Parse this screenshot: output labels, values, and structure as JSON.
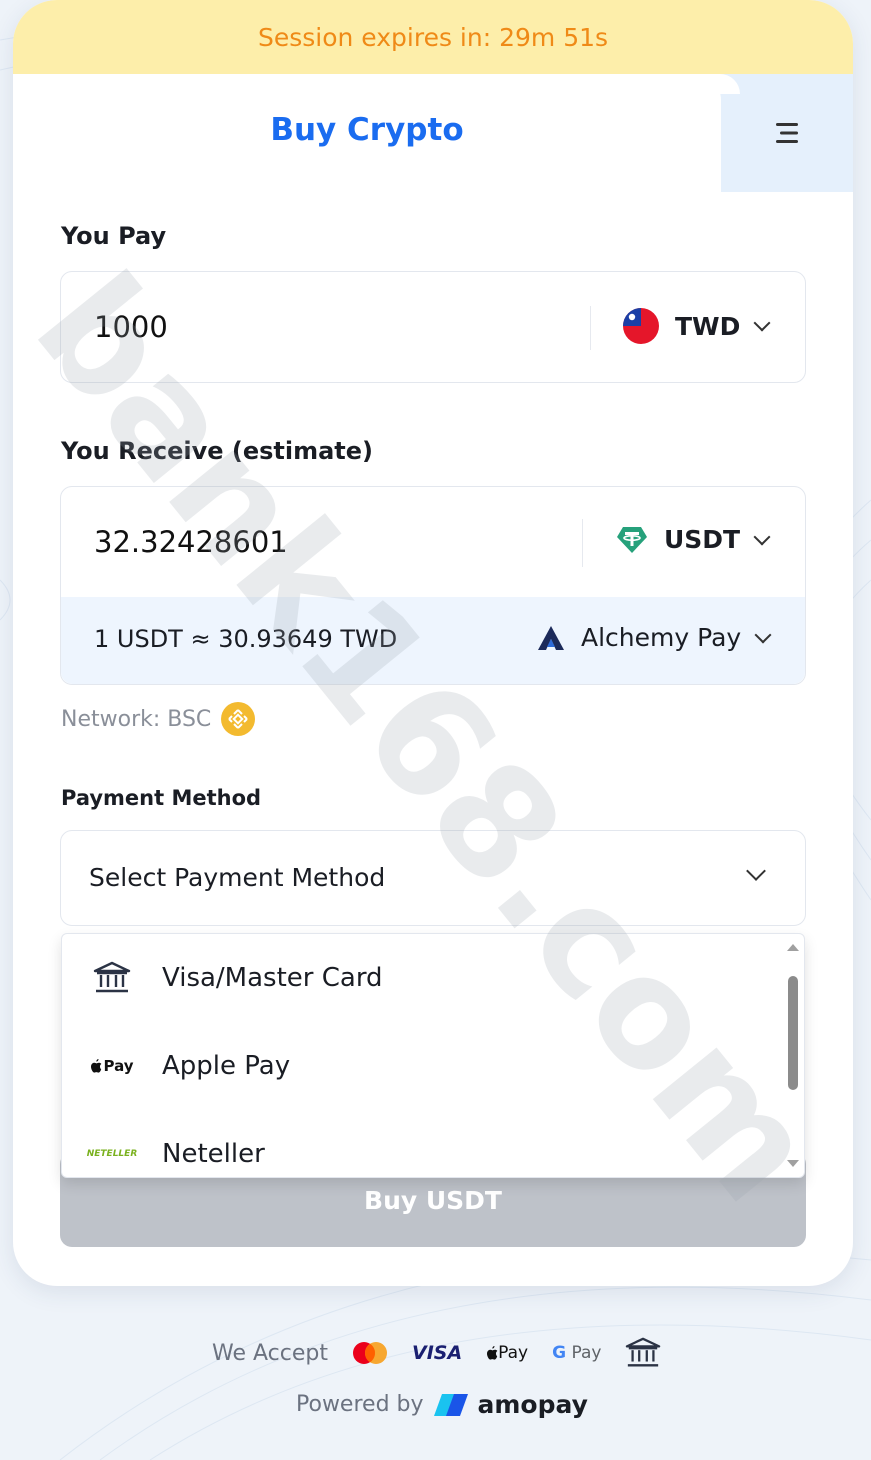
{
  "session": {
    "text": "Session expires in: 29m 51s"
  },
  "header": {
    "title": "Buy Crypto",
    "menu_icon": "menu-icon"
  },
  "pay": {
    "label": "You Pay",
    "amount": "1000",
    "currency": "TWD",
    "flag_icon": "taiwan-flag-icon"
  },
  "receive": {
    "label": "You Receive (estimate)",
    "amount": "32.32428601",
    "currency": "USDT",
    "token_icon": "tether-icon",
    "rate": "1 USDT ≈ 30.93649 TWD",
    "provider": "Alchemy Pay",
    "provider_icon": "alchemy-pay-icon"
  },
  "network": {
    "label": "Network: BSC",
    "icon": "bnb-icon"
  },
  "payment": {
    "label": "Payment Method",
    "placeholder": "Select Payment Method",
    "options": [
      {
        "label": "Visa/Master Card",
        "icon": "bank-icon"
      },
      {
        "label": "Apple Pay",
        "icon": "apple-pay-icon",
        "icon_text": "Pay"
      },
      {
        "label": "Neteller",
        "icon": "neteller-icon",
        "icon_text": "NETELLER"
      }
    ]
  },
  "buy_button": {
    "label": "Buy USDT"
  },
  "footer": {
    "accept_label": "We Accept",
    "visa_text": "VISA",
    "applepay_text": "Pay",
    "gpay_text": "Pay",
    "powered_label": "Powered by",
    "brand": "amopay"
  },
  "watermark": {
    "text": "bank168.com"
  },
  "colors": {
    "accent": "#1a6cf0",
    "session_bg": "#fdeeaa",
    "session_text": "#ef8a17",
    "button_disabled": "#bec2c9"
  }
}
